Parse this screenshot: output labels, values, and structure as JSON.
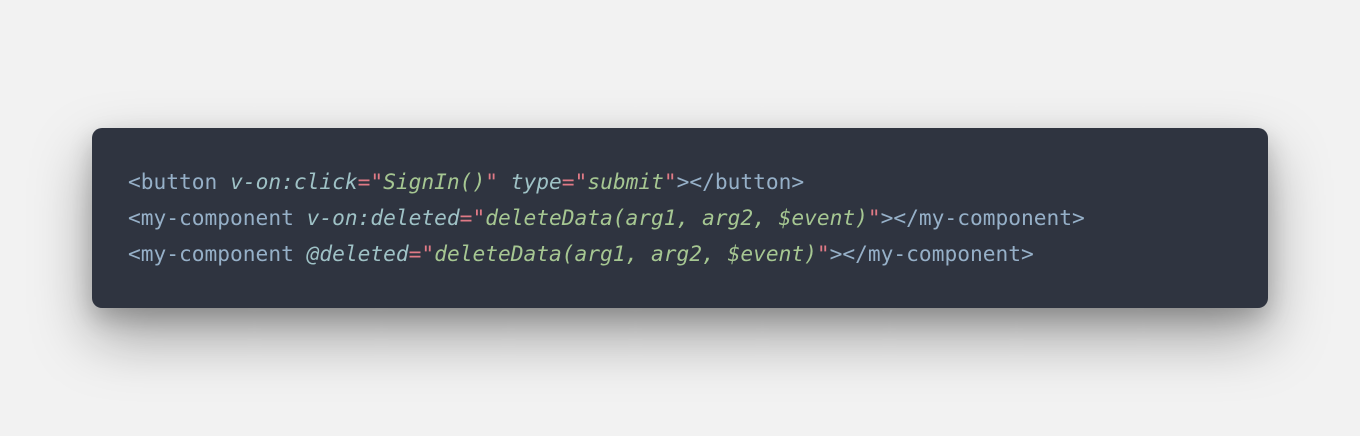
{
  "code_block": {
    "colors": {
      "page_background": "#f2f2f2",
      "card_background": "#2f3440",
      "tag": "#96b0c8",
      "attribute": "#9fc2c6",
      "punctuation": "#e07a86",
      "string": "#a6c792"
    },
    "lines": [
      {
        "tokens": [
          {
            "type": "tag",
            "text": "<button"
          },
          {
            "type": "space",
            "text": " "
          },
          {
            "type": "attr",
            "text": "v-on:click"
          },
          {
            "type": "eq",
            "text": "="
          },
          {
            "type": "quote",
            "text": "\""
          },
          {
            "type": "val",
            "text": "SignIn()"
          },
          {
            "type": "quote",
            "text": "\""
          },
          {
            "type": "space",
            "text": " "
          },
          {
            "type": "attr",
            "text": "type"
          },
          {
            "type": "eq",
            "text": "="
          },
          {
            "type": "quote",
            "text": "\""
          },
          {
            "type": "val",
            "text": "submit"
          },
          {
            "type": "quote",
            "text": "\""
          },
          {
            "type": "tag",
            "text": "></button>"
          }
        ]
      },
      {
        "tokens": [
          {
            "type": "tag",
            "text": "<my-component"
          },
          {
            "type": "space",
            "text": " "
          },
          {
            "type": "attr",
            "text": "v-on:deleted"
          },
          {
            "type": "eq",
            "text": "="
          },
          {
            "type": "quote",
            "text": "\""
          },
          {
            "type": "val",
            "text": "deleteData(arg1, arg2, $event)"
          },
          {
            "type": "quote",
            "text": "\""
          },
          {
            "type": "tag",
            "text": "></my-component>"
          }
        ]
      },
      {
        "tokens": [
          {
            "type": "tag",
            "text": "<my-component"
          },
          {
            "type": "space",
            "text": " "
          },
          {
            "type": "attr",
            "text": "@deleted"
          },
          {
            "type": "eq",
            "text": "="
          },
          {
            "type": "quote",
            "text": "\""
          },
          {
            "type": "val",
            "text": "deleteData(arg1, arg2, $event)"
          },
          {
            "type": "quote",
            "text": "\""
          },
          {
            "type": "tag",
            "text": "></my-component>"
          }
        ]
      }
    ]
  }
}
